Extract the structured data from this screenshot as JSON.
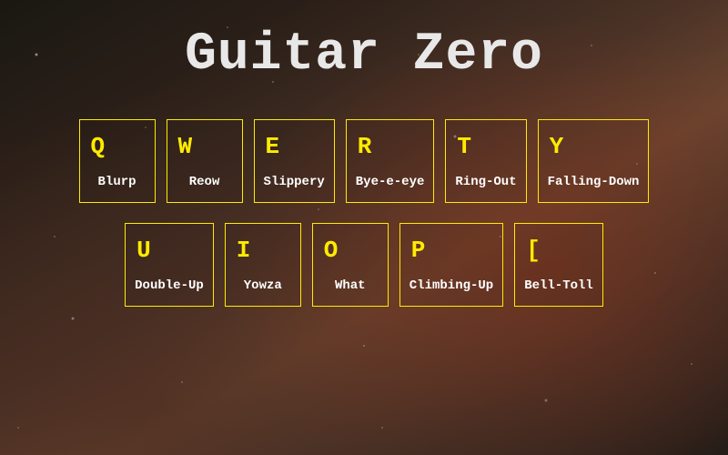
{
  "title": "Guitar Zero",
  "rows": [
    [
      {
        "key": "Q",
        "label": "Blurp"
      },
      {
        "key": "W",
        "label": "Reow"
      },
      {
        "key": "E",
        "label": "Slippery"
      },
      {
        "key": "R",
        "label": "Bye-e-eye"
      },
      {
        "key": "T",
        "label": "Ring-Out"
      },
      {
        "key": "Y",
        "label": "Falling-Down"
      }
    ],
    [
      {
        "key": "U",
        "label": "Double-Up"
      },
      {
        "key": "I",
        "label": "Yowza"
      },
      {
        "key": "O",
        "label": "What"
      },
      {
        "key": "P",
        "label": "Climbing-Up"
      },
      {
        "key": "[",
        "label": "Bell-Toll"
      }
    ]
  ]
}
